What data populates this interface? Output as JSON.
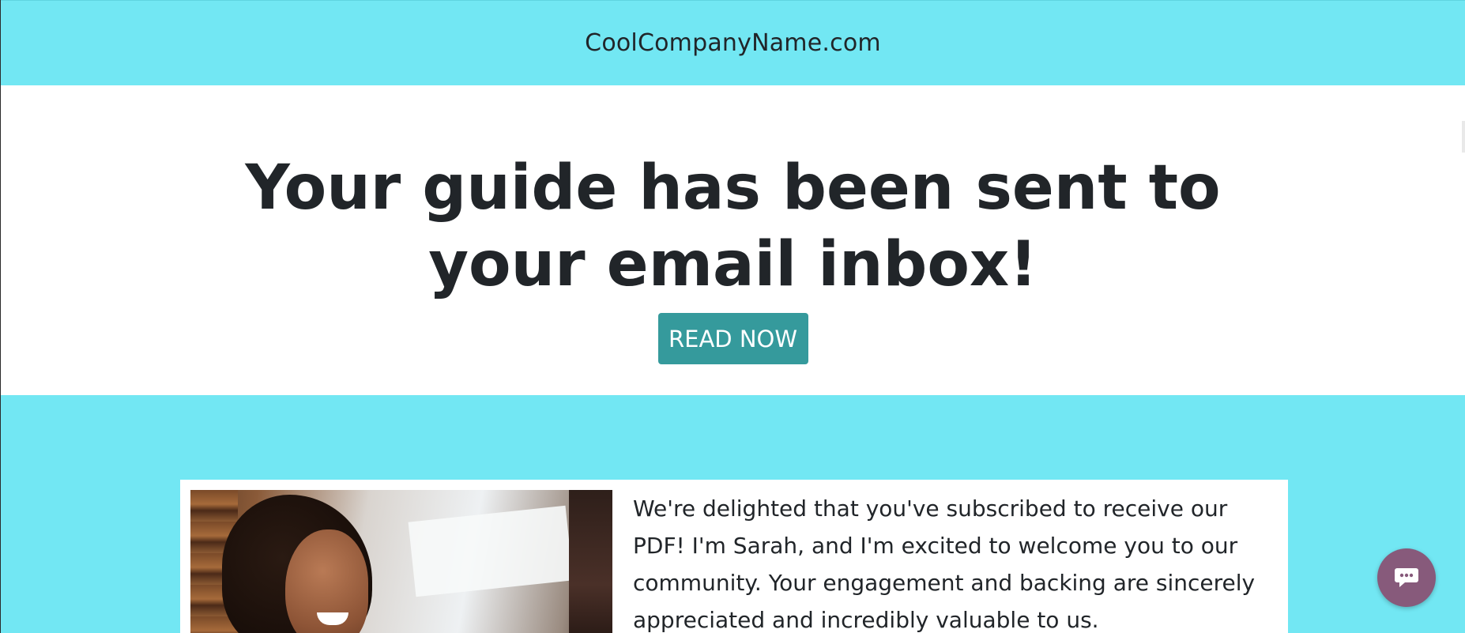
{
  "header": {
    "brand": "CoolCompanyName.com"
  },
  "hero": {
    "title": "Your guide has been sent to your email inbox!",
    "cta_label": "READ NOW"
  },
  "welcome_card": {
    "text": "We're delighted that you've subscribed to receive our PDF! I'm Sarah, and I'm excited to welcome you to our community. Your engagement and backing are sincerely appreciated and incredibly valuable to us."
  },
  "chat": {
    "icon": "chat-bubble-icon"
  },
  "colors": {
    "band": "#72e7f3",
    "cta": "#359a9c",
    "chat": "#875a7b",
    "text": "#212529"
  }
}
